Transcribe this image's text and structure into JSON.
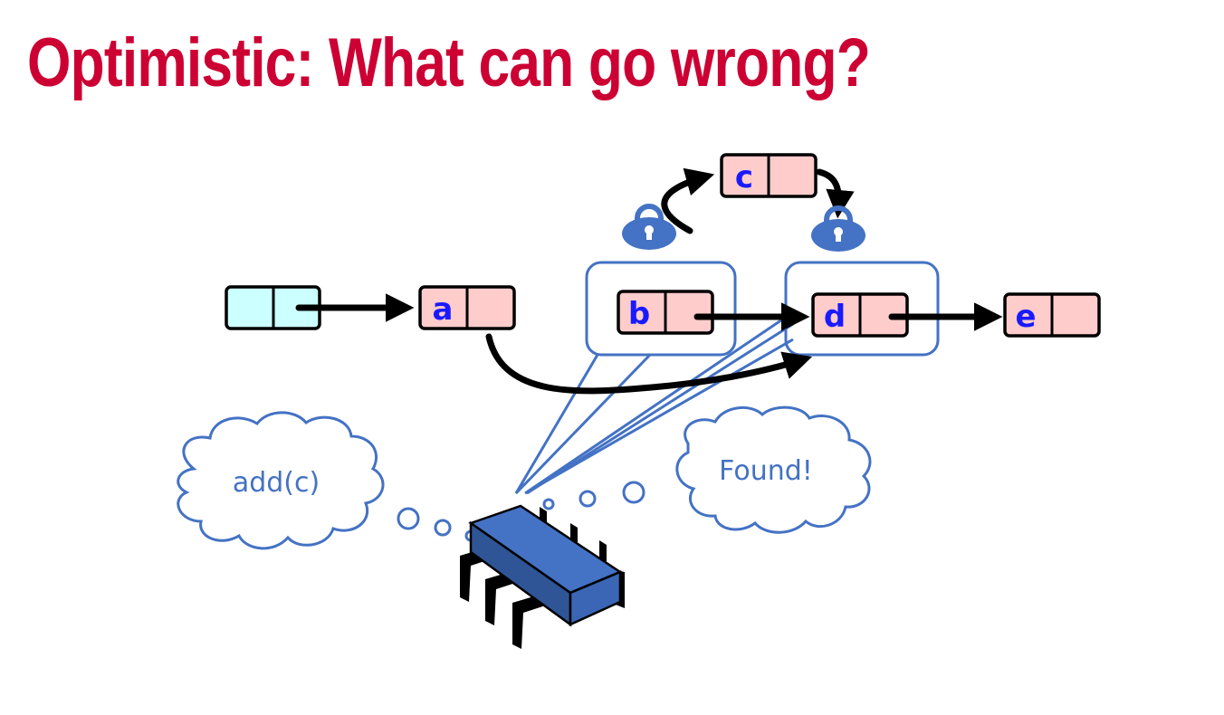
{
  "slide": {
    "title": "Optimistic: What can go wrong?"
  },
  "nodes": {
    "head": "",
    "a": "a",
    "b": "b",
    "c": "c",
    "d": "d",
    "e": "e"
  },
  "thoughts": {
    "left": "add(c)",
    "right": "Found!"
  },
  "colors": {
    "title": "#cc0033",
    "node_fill": "#ffcccc",
    "head_fill": "#ccffff",
    "label": "#1a1aff",
    "accent_blue": "#4472c4",
    "arrow": "#000000"
  },
  "icons": {
    "lock_b": "padlock-icon",
    "lock_d": "padlock-icon",
    "thread": "thread-bug-icon"
  }
}
